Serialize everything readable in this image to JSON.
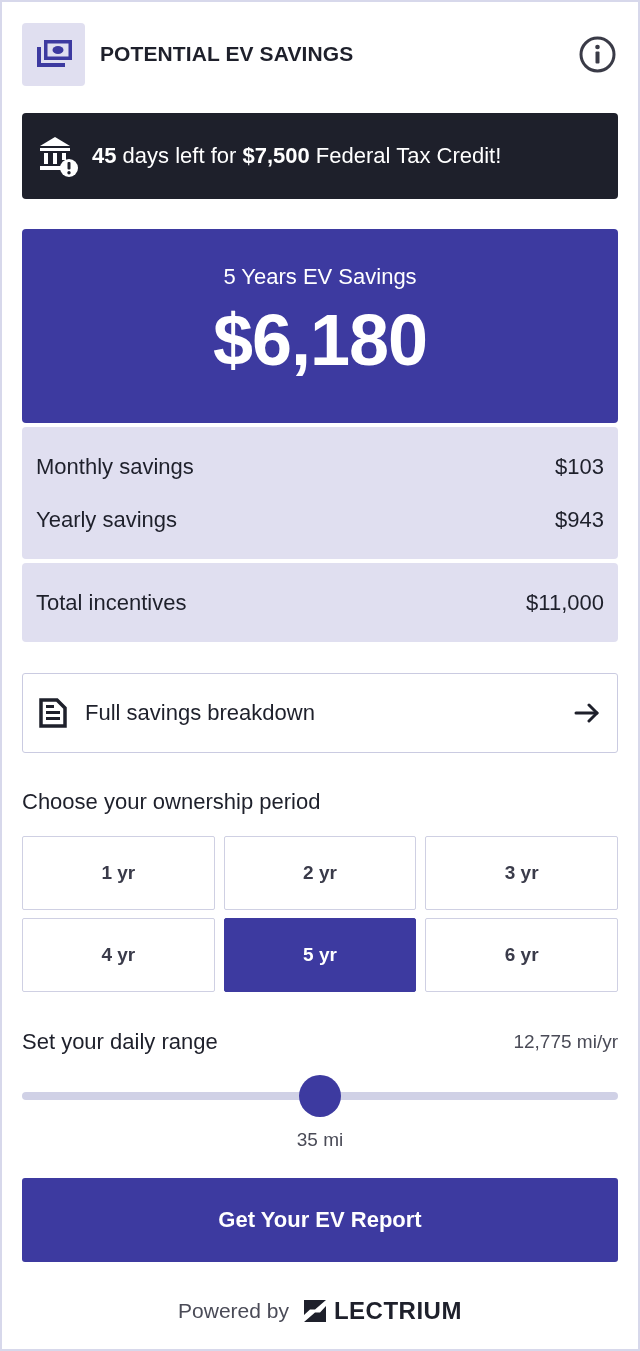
{
  "header": {
    "title": "POTENTIAL EV SAVINGS"
  },
  "banner": {
    "text": "**45** days left for **$7,500** Federal Tax Credit!"
  },
  "hero": {
    "label": "5 Years EV Savings",
    "amount": "$6,180"
  },
  "stats": [
    {
      "rows": [
        {
          "label": "Monthly savings",
          "value": "$103"
        },
        {
          "label": "Yearly savings",
          "value": "$943"
        }
      ]
    },
    {
      "rows": [
        {
          "label": "Total incentives",
          "value": "$11,000"
        }
      ]
    }
  ],
  "breakdown_link": {
    "label": "Full savings breakdown"
  },
  "ownership": {
    "title": "Choose your ownership period",
    "options": [
      {
        "label": "1 yr",
        "selected": false
      },
      {
        "label": "2 yr",
        "selected": false
      },
      {
        "label": "3 yr",
        "selected": false
      },
      {
        "label": "4 yr",
        "selected": false
      },
      {
        "label": "5 yr",
        "selected": true
      },
      {
        "label": "6 yr",
        "selected": false
      }
    ]
  },
  "range": {
    "title": "Set your daily range",
    "annual": "12,775 mi/yr",
    "level": 0.5,
    "reading": "35 mi"
  },
  "cta": {
    "label": "Get Your EV Report"
  },
  "footer": {
    "powered_by": "Powered by",
    "brand": "LECTRIUM"
  }
}
